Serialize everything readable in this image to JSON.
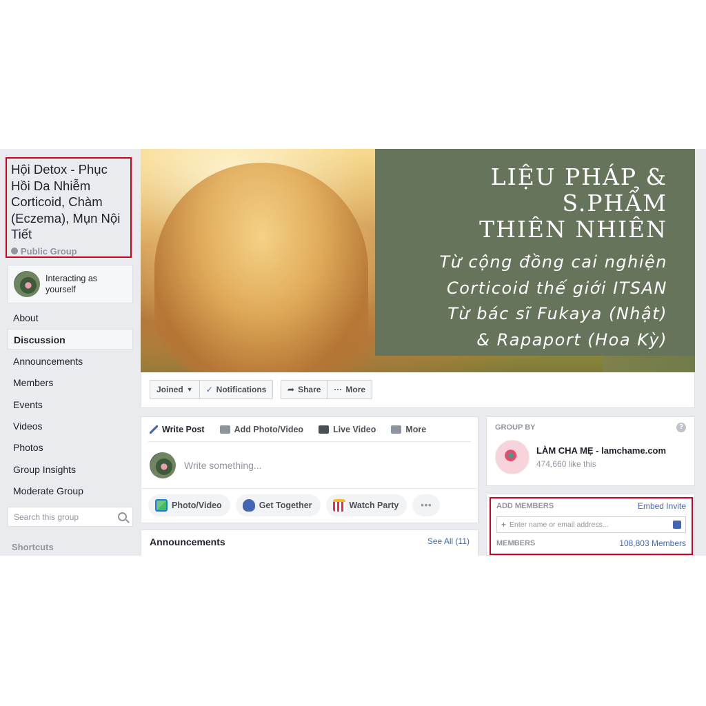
{
  "group": {
    "title": "Hội Detox - Phục Hồi Da Nhiễm Corticoid, Chàm (Eczema), Mụn Nội Tiết",
    "privacy": "Public Group"
  },
  "interacting_as": "Interacting as yourself",
  "nav": [
    "About",
    "Discussion",
    "Announcements",
    "Members",
    "Events",
    "Videos",
    "Photos",
    "Group Insights",
    "Moderate Group"
  ],
  "search": {
    "placeholder": "Search this group"
  },
  "shortcuts_label": "Shortcuts",
  "cover": {
    "line1": "LIỆU PHÁP & S.PHẨM",
    "line2": "THIÊN NHIÊN",
    "line3": "Từ cộng đồng cai nghiện",
    "line4": "Corticoid thế giới ITSAN",
    "line5": "Từ bác sĩ Fukaya (Nhật)",
    "line6": "& Rapaport (Hoa Kỳ)"
  },
  "actions": {
    "joined": "Joined",
    "notifications": "Notifications",
    "share": "Share",
    "more": "More"
  },
  "composer": {
    "tabs": [
      "Write Post",
      "Add Photo/Video",
      "Live Video",
      "More"
    ],
    "placeholder": "Write something...",
    "actions": [
      "Photo/Video",
      "Get Together",
      "Watch Party"
    ]
  },
  "announcements": {
    "title": "Announcements",
    "see_all": "See All (11)"
  },
  "group_by": {
    "label": "GROUP BY",
    "page_name": "LÀM CHA MẸ - lamchame.com",
    "likes": "474,660 like this"
  },
  "add_members": {
    "label": "ADD MEMBERS",
    "embed_invite": "Embed Invite",
    "placeholder": "Enter name or email address...",
    "members_label": "MEMBERS",
    "members_count": "108,803 Members"
  },
  "colors": {
    "highlight_border": "#d0021b",
    "link": "#4267b2",
    "cover_panel": "#65745a",
    "background": "#e9ebee"
  }
}
